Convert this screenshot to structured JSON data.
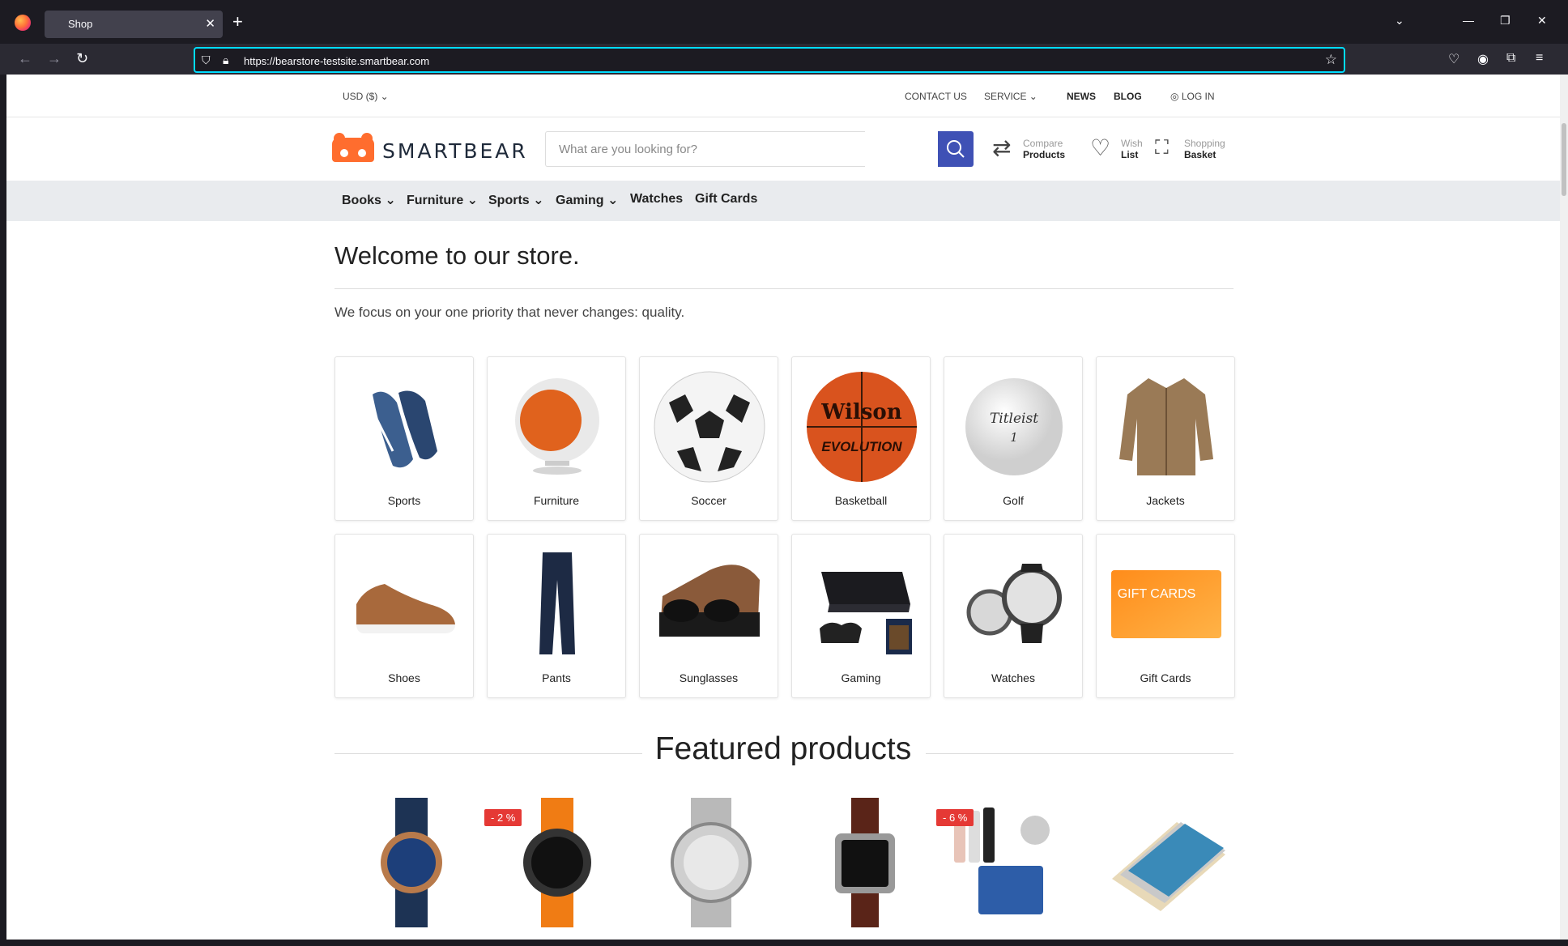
{
  "browser": {
    "tab_title": "Shop",
    "url": "https://bearstore-testsite.smartbear.com"
  },
  "topbar": {
    "currency": "USD   ($)",
    "contact": "CONTACT US",
    "service": "SERVICE",
    "news": "NEWS",
    "blog": "BLOG",
    "login": "LOG IN"
  },
  "header": {
    "logo_text": "SMARTBEAR",
    "search_placeholder": "What are you looking for?",
    "compare": {
      "line1": "Compare",
      "line2": "Products"
    },
    "wish": {
      "line1": "Wish",
      "line2": "List"
    },
    "basket": {
      "line1": "Shopping",
      "line2": "Basket"
    }
  },
  "catnav": [
    "Books",
    "Furniture",
    "Sports",
    "Gaming",
    "Watches",
    "Gift Cards"
  ],
  "main": {
    "welcome": "Welcome to our store.",
    "subtitle": "We focus on your one priority that never changes: quality."
  },
  "categories": [
    "Sports",
    "Furniture",
    "Soccer",
    "Basketball",
    "Golf",
    "Jackets",
    "Shoes",
    "Pants",
    "Sunglasses",
    "Gaming",
    "Watches",
    "Gift Cards"
  ],
  "featured": {
    "title": "Featured products",
    "badges": [
      "- 2 %",
      "- 6 %"
    ],
    "gift_card_text": "GIFT CARDS",
    "wilson_text": "Wilson",
    "evolution_text": "EVOLUTION",
    "titleist_text": "Titleist",
    "titleist_number": "1"
  }
}
